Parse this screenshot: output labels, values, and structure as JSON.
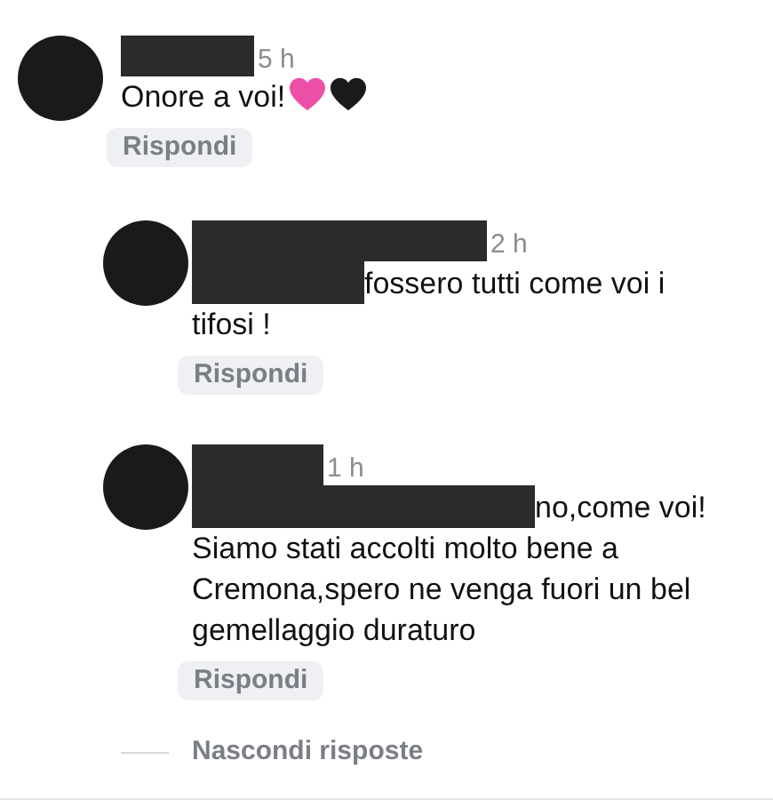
{
  "comments": [
    {
      "name_redacted": true,
      "time": "5 h",
      "body": [
        {
          "kind": "text",
          "text": "Onore a voi!"
        },
        {
          "kind": "pink-heart"
        },
        {
          "kind": "black-heart"
        }
      ],
      "reply_label": "Rispondi",
      "children": [
        {
          "name_redacted": true,
          "time": "2 h",
          "body": [
            {
              "kind": "redacted"
            },
            {
              "kind": "text",
              "text": "fossero tutti come voi i"
            },
            {
              "kind": "paragraph",
              "text": "tifosi !"
            }
          ],
          "reply_label": "Rispondi"
        },
        {
          "name_redacted": true,
          "time": "1 h",
          "body": [
            {
              "kind": "redacted"
            },
            {
              "kind": "text",
              "text": "no,come voi!"
            },
            {
              "kind": "paragraph",
              "text": "Siamo stati accolti molto bene a Cremona,spero ne venga fuori un bel gemellaggio duraturo"
            }
          ],
          "reply_label": "Rispondi"
        }
      ]
    }
  ],
  "hide_replies": "Nascondi risposte"
}
